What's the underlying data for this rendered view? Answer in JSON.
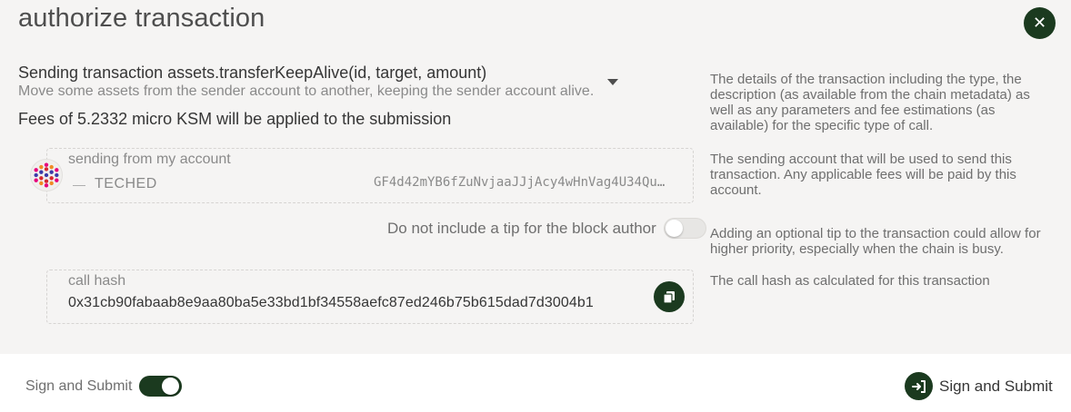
{
  "modal": {
    "title": "authorize transaction",
    "close_icon": "close-icon"
  },
  "transaction": {
    "method": "Sending transaction assets.transferKeepAlive(id, target, amount)",
    "description": "Move some assets from the sender account to another, keeping the sender account alive.",
    "fees": "Fees of 5.2332 micro KSM will be applied to the submission"
  },
  "account": {
    "label": "sending from my account",
    "name": "TECHED",
    "address": "GF4d42mYB6fZuNvjaaJJjAcy4wHnVag4U34Qu…"
  },
  "tip": {
    "label": "Do not include a tip for the block author",
    "enabled": false
  },
  "call_hash": {
    "label": "call hash",
    "value": "0x31cb90fabaab8e9aa80ba5e33bd1bf34558aefc87ed246b75b615dad7d3004b1",
    "copy_icon": "copy-icon"
  },
  "help": {
    "details": "The details of the transaction including the type, the description (as available from the chain metadata) as well as any parameters and fee estimations (as available) for the specific type of call.",
    "sending": "The sending account that will be used to send this transaction. Any applicable fees will be paid by this account.",
    "tip": "Adding an optional tip to the transaction could allow for higher priority, especially when the chain is busy.",
    "hash": "The call hash as calculated for this transaction"
  },
  "footer": {
    "toggle_label": "Sign and Submit",
    "toggle_on": true,
    "submit_label": "Sign and Submit",
    "submit_icon": "sign-in-icon"
  },
  "colors": {
    "accent": "#1b3a1f",
    "background": "#f5f4f3",
    "footer_background": "#ffffff"
  }
}
